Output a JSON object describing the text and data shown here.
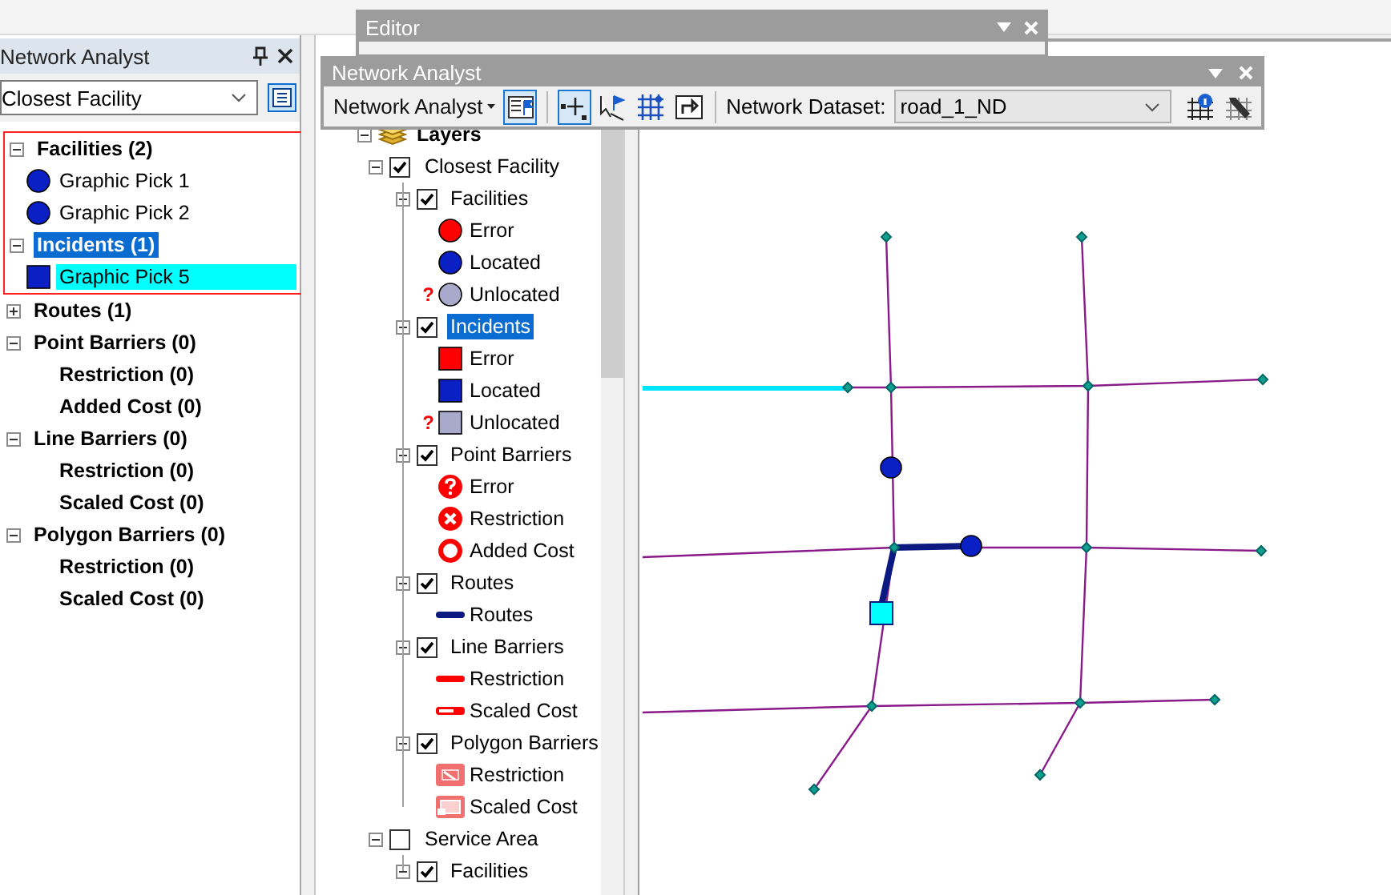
{
  "network_analyst_window": {
    "title": "Network Analyst",
    "analysis": "Closest Facility",
    "classes": [
      {
        "label": "Facilities (2)",
        "expanded": true,
        "selected": false,
        "boxed": true,
        "children": [
          {
            "label": "Graphic Pick 1",
            "kind": "facility",
            "selected": false
          },
          {
            "label": "Graphic Pick 2",
            "kind": "facility",
            "selected": false
          }
        ]
      },
      {
        "label": "Incidents (1)",
        "expanded": true,
        "selected": true,
        "boxed": true,
        "children": [
          {
            "label": "Graphic Pick 5",
            "kind": "incident",
            "selected": true
          }
        ]
      },
      {
        "label": "Routes (1)",
        "expanded": false,
        "selected": false,
        "boxed": false
      },
      {
        "label": "Point Barriers (0)",
        "expanded": true,
        "selected": false,
        "boxed": false,
        "children": [
          {
            "label": "Restriction (0)",
            "kind": "subclass",
            "selected": false
          },
          {
            "label": "Added Cost (0)",
            "kind": "subclass",
            "selected": false
          }
        ]
      },
      {
        "label": "Line Barriers (0)",
        "expanded": true,
        "selected": false,
        "boxed": false,
        "children": [
          {
            "label": "Restriction (0)",
            "kind": "subclass",
            "selected": false
          },
          {
            "label": "Scaled Cost (0)",
            "kind": "subclass",
            "selected": false
          }
        ]
      },
      {
        "label": "Polygon Barriers (0)",
        "expanded": true,
        "selected": false,
        "boxed": false,
        "children": [
          {
            "label": "Restriction (0)",
            "kind": "subclass",
            "selected": false
          },
          {
            "label": "Scaled Cost (0)",
            "kind": "subclass",
            "selected": false
          }
        ]
      }
    ]
  },
  "table_of_contents": {
    "root": {
      "label": "Layers",
      "expanded": true,
      "children": [
        {
          "label": "Closest Facility",
          "checked": true,
          "expanded": true,
          "children": [
            {
              "label": "Facilities",
              "checked": true,
              "expanded": true,
              "selected": false,
              "legend": [
                {
                  "label": "Error",
                  "kind": "circle",
                  "color": "#ff0000"
                },
                {
                  "label": "Located",
                  "kind": "circle",
                  "color": "#0a1fc4"
                },
                {
                  "label": "Unlocated",
                  "kind": "circle",
                  "color": "#a9aacb",
                  "flag": "?"
                }
              ]
            },
            {
              "label": "Incidents",
              "checked": true,
              "expanded": true,
              "selected": true,
              "legend": [
                {
                  "label": "Error",
                  "kind": "square",
                  "color": "#ff0000"
                },
                {
                  "label": "Located",
                  "kind": "square",
                  "color": "#0a1fc4"
                },
                {
                  "label": "Unlocated",
                  "kind": "square",
                  "color": "#a9aacb",
                  "flag": "?"
                }
              ]
            },
            {
              "label": "Point Barriers",
              "checked": true,
              "expanded": true,
              "selected": false,
              "legend": [
                {
                  "label": "Error",
                  "kind": "question-circle",
                  "color": "#ff0000"
                },
                {
                  "label": "Restriction",
                  "kind": "cross-circle",
                  "color": "#ff0000"
                },
                {
                  "label": "Added Cost",
                  "kind": "ring",
                  "color": "#ff0000"
                }
              ]
            },
            {
              "label": "Routes",
              "checked": true,
              "expanded": true,
              "selected": false,
              "legend": [
                {
                  "label": "Routes",
                  "kind": "line",
                  "color": "#0a1a80"
                }
              ]
            },
            {
              "label": "Line Barriers",
              "checked": true,
              "expanded": true,
              "selected": false,
              "legend": [
                {
                  "label": "Restriction",
                  "kind": "line",
                  "color": "#ff0000"
                },
                {
                  "label": "Scaled Cost",
                  "kind": "hollow-line",
                  "color": "#ff0000"
                }
              ]
            },
            {
              "label": "Polygon Barriers",
              "checked": true,
              "expanded": true,
              "selected": false,
              "legend": [
                {
                  "label": "Restriction",
                  "kind": "polygon",
                  "color": "#f07070"
                },
                {
                  "label": "Scaled Cost",
                  "kind": "polygon-scaled",
                  "color": "#f07070"
                }
              ]
            }
          ]
        },
        {
          "label": "Service Area",
          "checked": false,
          "expanded": true,
          "children": [
            {
              "label": "Facilities",
              "checked": true,
              "expanded": true,
              "selected": false
            }
          ]
        }
      ]
    }
  },
  "editor_toolbar": {
    "title": "Editor"
  },
  "network_analyst_toolbar": {
    "title": "Network Analyst",
    "menu": "Network Analyst",
    "tools": [
      {
        "kind": "window",
        "selected": true
      },
      {
        "kind": "create-location",
        "selected": true
      },
      {
        "kind": "select-location",
        "selected": false
      },
      {
        "kind": "build",
        "selected": false
      },
      {
        "kind": "solve",
        "selected": false
      }
    ],
    "dataset_label": "Network Dataset:",
    "dataset": "road_1_ND",
    "extra_tools": [
      {
        "kind": "info",
        "selected": false
      },
      {
        "kind": "properties",
        "selected": false
      }
    ]
  },
  "map": {
    "kind": "network"
  }
}
